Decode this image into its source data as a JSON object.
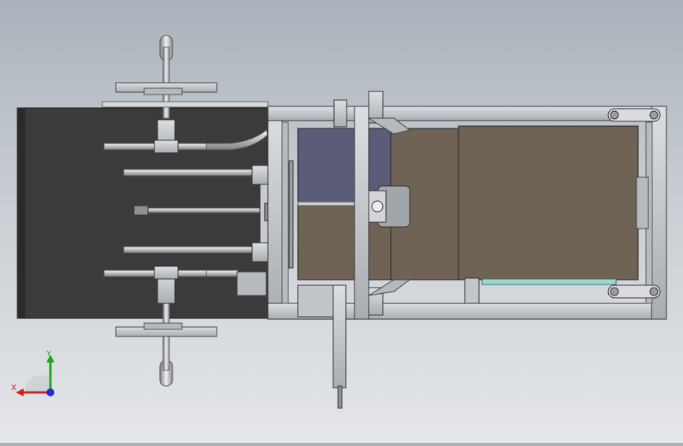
{
  "viewport": {
    "view_orientation": "top",
    "background": [
      "#aab2bb",
      "#e4e6e8"
    ]
  },
  "model": {
    "conveyor_belt_color": "#3b3b3b",
    "frame_color": "#c3c6ca",
    "panel_color_brown": "#6e6354",
    "panel_color_slate": "#5b5c78",
    "strip_color_teal": "#9fd6d1"
  },
  "triad": {
    "x_label": "X",
    "y_label": "Y",
    "x_color": "#d42020",
    "y_color": "#1aa81a",
    "z_color": "#2030d0"
  }
}
